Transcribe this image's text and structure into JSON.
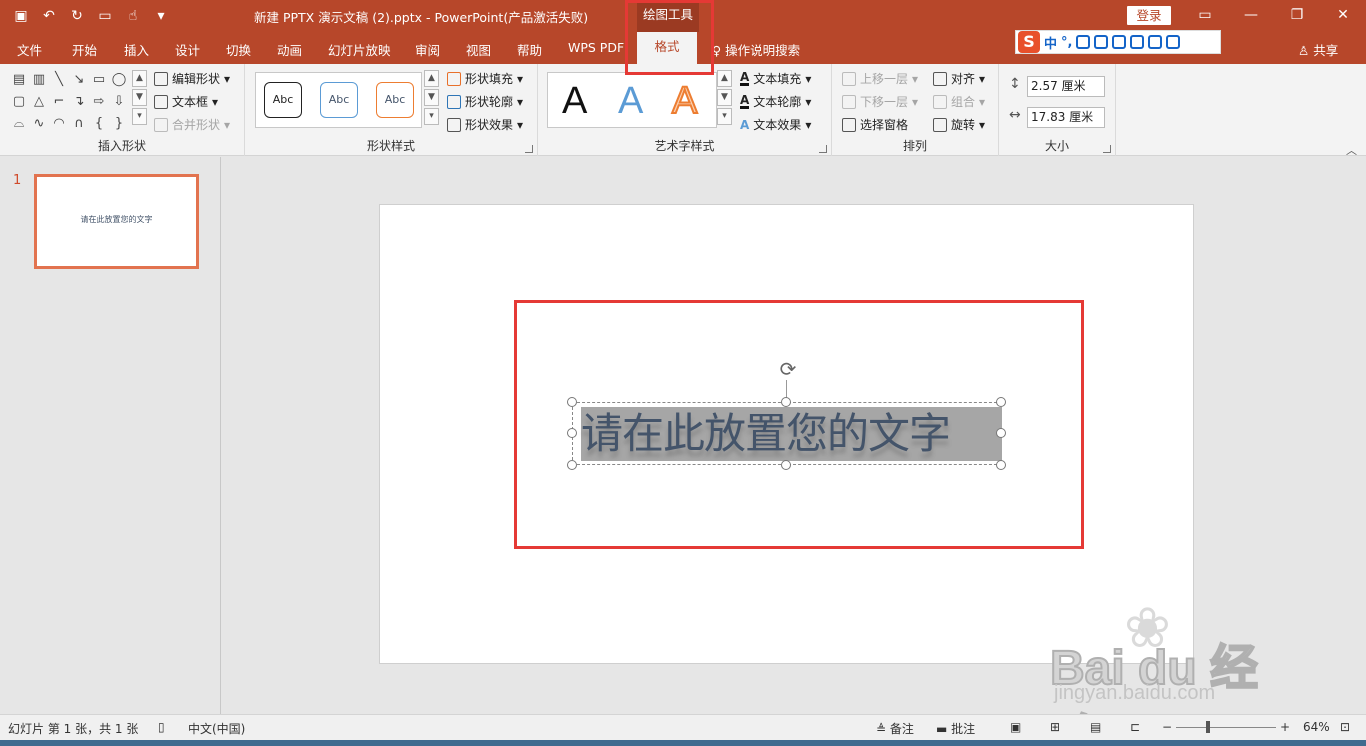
{
  "titlebar": {
    "title": "新建 PPTX 演示文稿 (2).pptx  -  PowerPoint(产品激活失败)",
    "context_group": "绘图工具",
    "login": "登录",
    "qat_icons": [
      "save-icon",
      "undo-icon",
      "redo-icon",
      "present-icon",
      "touch-icon",
      "customize-icon"
    ],
    "window_icons": [
      "ribbon-display-icon",
      "minimize-icon",
      "restore-icon",
      "close-icon"
    ]
  },
  "tabs": [
    {
      "label": "文件"
    },
    {
      "label": "开始"
    },
    {
      "label": "插入"
    },
    {
      "label": "设计"
    },
    {
      "label": "切换"
    },
    {
      "label": "动画"
    },
    {
      "label": "幻灯片放映"
    },
    {
      "label": "审阅"
    },
    {
      "label": "视图"
    },
    {
      "label": "帮助"
    },
    {
      "label": "WPS PDF"
    },
    {
      "label": "格式"
    }
  ],
  "tell_me": "操作说明搜索",
  "share": "共享",
  "ime": {
    "mode": "中",
    "punct": "°,"
  },
  "ribbon": {
    "insert_shapes": {
      "label": "插入形状",
      "edit_shape": "编辑形状",
      "text_box": "文本框",
      "merge_shapes": "合并形状"
    },
    "shape_styles": {
      "label": "形状样式",
      "samples": [
        "Abc",
        "Abc",
        "Abc"
      ],
      "fill": "形状填充",
      "outline": "形状轮廓",
      "effects": "形状效果"
    },
    "wordart": {
      "label": "艺术字样式",
      "samples": [
        "A",
        "A",
        "A"
      ],
      "text_fill": "文本填充",
      "text_outline": "文本轮廓",
      "text_effects": "文本效果"
    },
    "arrange": {
      "label": "排列",
      "bring_forward": "上移一层",
      "send_backward": "下移一层",
      "selection_pane": "选择窗格",
      "align": "对齐",
      "group": "组合",
      "rotate": "旋转"
    },
    "size": {
      "label": "大小",
      "height": "2.57 厘米",
      "width": "17.83 厘米"
    }
  },
  "thumbnail": {
    "number": "1",
    "text": "请在此放置您的文字"
  },
  "slide": {
    "placeholder_text": "请在此放置您的文字"
  },
  "watermark": {
    "brand": "Bai  du 经验",
    "url": "jingyan.baidu.com"
  },
  "statusbar": {
    "slide_info": "幻灯片 第 1 张，共 1 张",
    "language": "中文(中国)",
    "notes": "备注",
    "comments": "批注",
    "zoom_minus": "−",
    "zoom_plus": "+",
    "zoom": "64%"
  },
  "colors": {
    "accent": "#b7472a",
    "highlight": "#e53935",
    "text": "#44546a"
  }
}
